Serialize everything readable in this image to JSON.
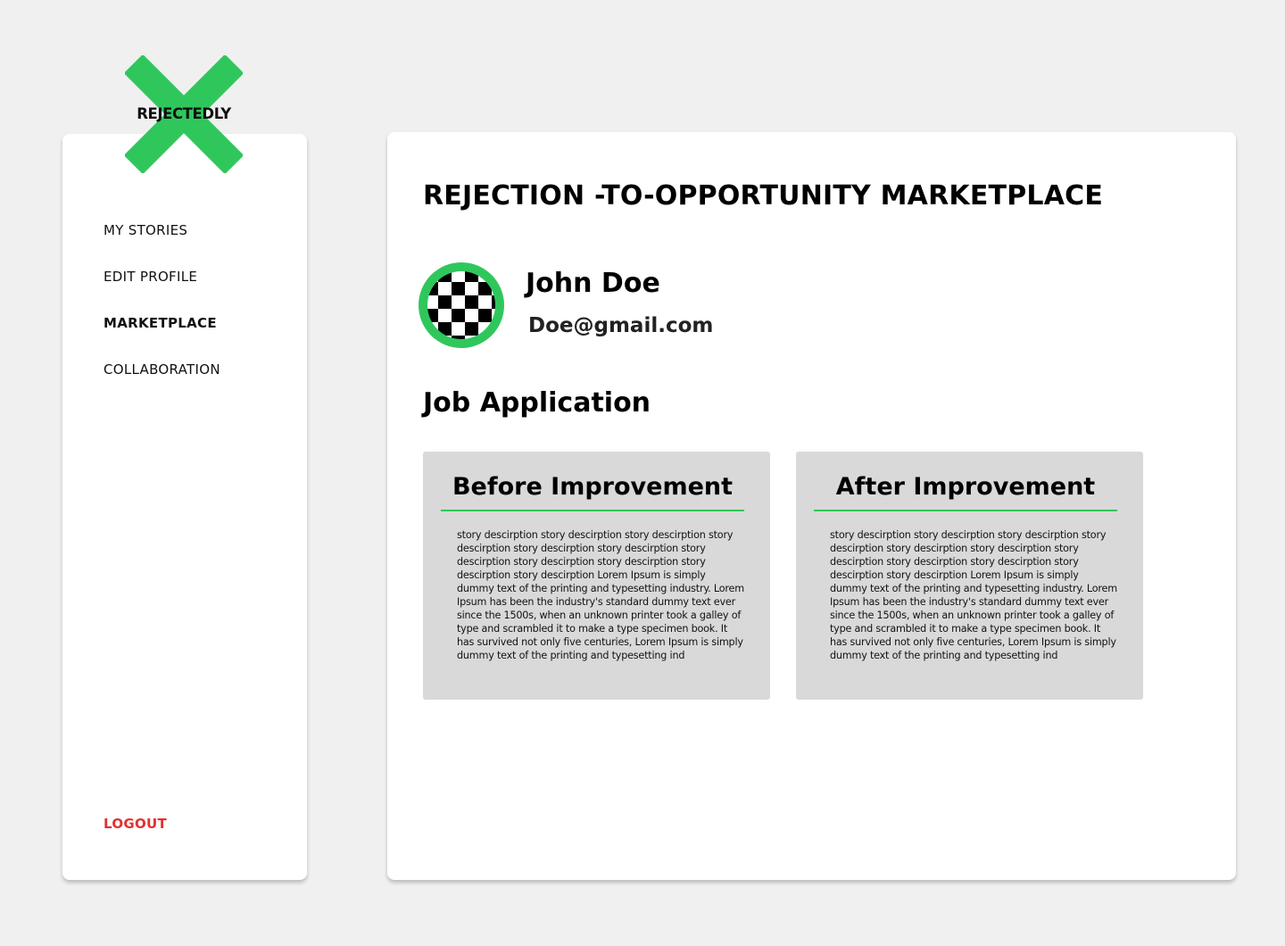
{
  "brand": {
    "name": "REJECTEDLY",
    "accent_color": "#2fc75c"
  },
  "sidebar": {
    "items": [
      {
        "label": "MY STORIES"
      },
      {
        "label": "EDIT PROFILE"
      },
      {
        "label": "MARKETPLACE",
        "active": true
      },
      {
        "label": "COLLABORATION"
      }
    ],
    "logout_label": "LOGOUT",
    "logout_color": "#e03131"
  },
  "main": {
    "title": "REJECTION -TO-OPPORTUNITY MARKETPLACE",
    "user": {
      "name": "John Doe",
      "email": "Doe@gmail.com",
      "avatar_icon": "checkered-avatar"
    },
    "section_title": "Job Application",
    "panels": [
      {
        "title": "Before Improvement",
        "text": "story descirption story descirption story descirption story descirption story descirption story descirption story descirption story descirption story descirption story descirption story descirption  Lorem Ipsum is simply dummy text of the printing and typesetting industry. Lorem Ipsum has been the industry's standard dummy text ever since the 1500s, when an unknown printer took a galley of type and scrambled it to make a type specimen book. It has survived not only five centuries, Lorem Ipsum is simply dummy text of the printing and typesetting ind"
      },
      {
        "title": "After Improvement",
        "text": "story descirption story descirption story descirption story descirption story descirption story descirption story descirption story descirption story descirption story descirption story descirption  Lorem Ipsum is simply dummy text of the printing and typesetting industry. Lorem Ipsum has been the industry's standard dummy text ever since the 1500s, when an unknown printer took a galley of type and scrambled it to make a type specimen book. It has survived not only five centuries, Lorem Ipsum is simply dummy text of the printing and typesetting ind"
      }
    ]
  }
}
